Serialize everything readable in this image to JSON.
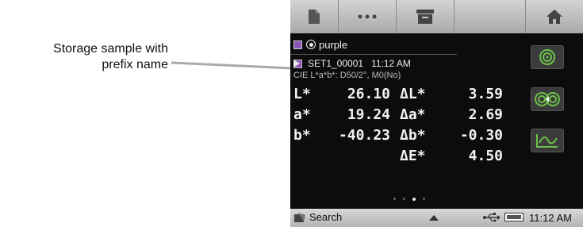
{
  "callout": {
    "line1": "Storage sample with",
    "line2": "prefix name"
  },
  "toolbar": {
    "buttons": [
      "document-icon",
      "more-icon",
      "archive-icon",
      "blank",
      "home-icon"
    ]
  },
  "standard": {
    "name": "purple",
    "swatch_color": "#8c56b8"
  },
  "sample": {
    "name": "SET1_00001",
    "time": "11:12 AM",
    "condition": "CIE L*a*b*: D50/2°, M0(No)"
  },
  "readings": [
    {
      "label": "L*",
      "value": "26.10",
      "delta_label": "ΔL*",
      "delta_value": "3.59"
    },
    {
      "label": "a*",
      "value": "19.24",
      "delta_label": "Δa*",
      "delta_value": "2.69"
    },
    {
      "label": "b*",
      "value": "-40.23",
      "delta_label": "Δb*",
      "delta_value": "-0.30"
    },
    {
      "label": "",
      "value": "",
      "delta_label": "ΔE*",
      "delta_value": "4.50"
    }
  ],
  "pager": {
    "active_page": 3,
    "page_count": 4
  },
  "side_buttons": [
    "target-icon",
    "compare-icon",
    "trend-icon"
  ],
  "accent_color": "#6cc24a",
  "statusbar": {
    "search_label": "Search",
    "clock": "11:12 AM"
  }
}
